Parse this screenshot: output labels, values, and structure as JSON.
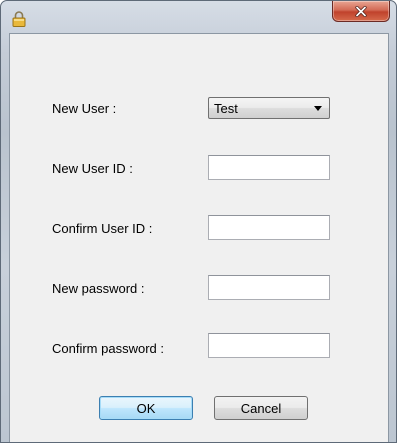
{
  "window": {
    "icon": "lock-icon",
    "close_icon": "close-icon"
  },
  "form": {
    "new_user_label": "New User :",
    "new_user_value": "Test",
    "new_user_id_label": "New User ID :",
    "new_user_id_value": "",
    "confirm_user_id_label": "Confirm User ID :",
    "confirm_user_id_value": "",
    "new_password_label": "New password :",
    "new_password_value": "",
    "confirm_password_label": "Confirm password :",
    "confirm_password_value": ""
  },
  "buttons": {
    "ok_label": "OK",
    "cancel_label": "Cancel"
  },
  "colors": {
    "close_button": "#c7432c",
    "client_background": "#f0f0f0",
    "default_button_border": "#3c7fb1"
  }
}
